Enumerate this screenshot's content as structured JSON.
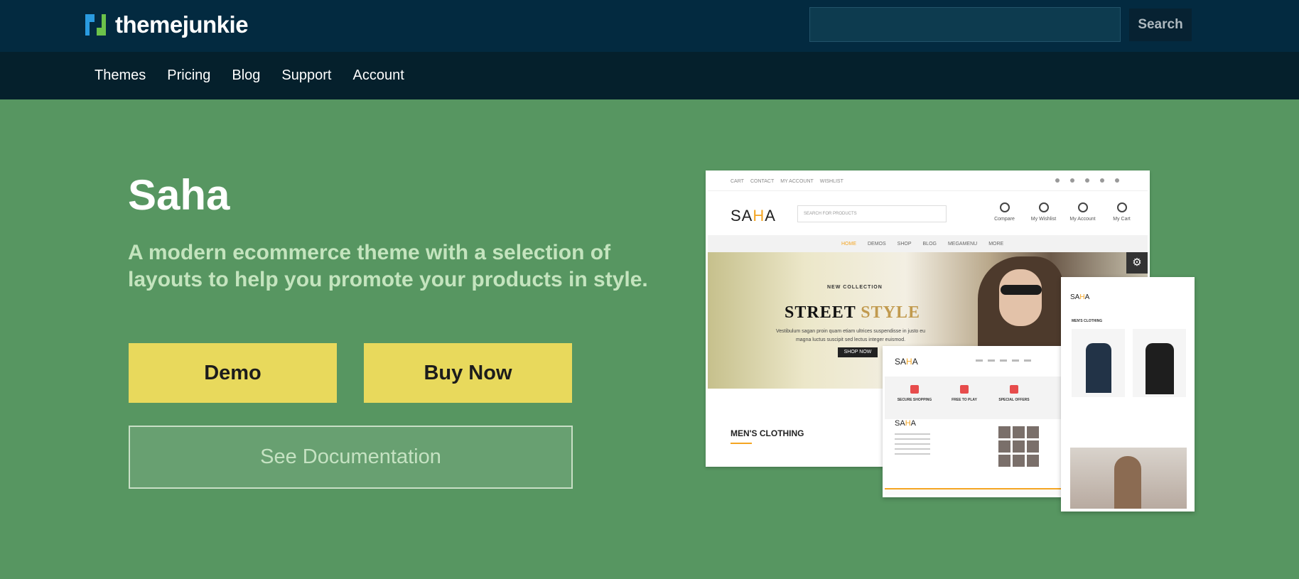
{
  "brand": {
    "name": "themejunkie"
  },
  "search": {
    "placeholder": "",
    "button_label": "Search"
  },
  "nav": {
    "items": [
      "Themes",
      "Pricing",
      "Blog",
      "Support",
      "Account"
    ]
  },
  "hero": {
    "title": "Saha",
    "subtitle": "A modern ecommerce theme with a selection of layouts to help you promote your products in style.",
    "demo_label": "Demo",
    "buy_label": "Buy Now",
    "docs_label": "See Documentation"
  },
  "preview": {
    "top_links": [
      "CART",
      "CONTACT",
      "MY ACCOUNT",
      "WISHLIST"
    ],
    "brand_left": "SA",
    "brand_accent": "H",
    "brand_right": "A",
    "search_placeholder": "SEARCH FOR PRODUCTS",
    "icons": [
      "Compare",
      "My Wishlist",
      "My Account",
      "My Cart"
    ],
    "menu": [
      "HOME",
      "DEMOS",
      "SHOP",
      "BLOG",
      "MEGAMENU",
      "MORE"
    ],
    "new_collection": "NEW COLLECTION",
    "street_word": "STREET ",
    "style_word": "STYLE",
    "banner_text": "Vestibulum sagan proin quam etiam ultrices suspendisse in justo eu magna luctus suscipit sed lectus integer euismod.",
    "shop_now": "SHOP NOW",
    "mens_clothing": "MEN'S CLOTHING",
    "features": [
      "SECURE SHOPPING",
      "FREE TO PLAY",
      "SPECIAL OFFERS"
    ],
    "right_title": "MEN'S CLOTHING"
  },
  "colors": {
    "topbar": "#032a40",
    "navbar": "#05202c",
    "hero_bg": "#579661",
    "button_yellow": "#e8d95c",
    "accent_orange": "#f4a522"
  }
}
